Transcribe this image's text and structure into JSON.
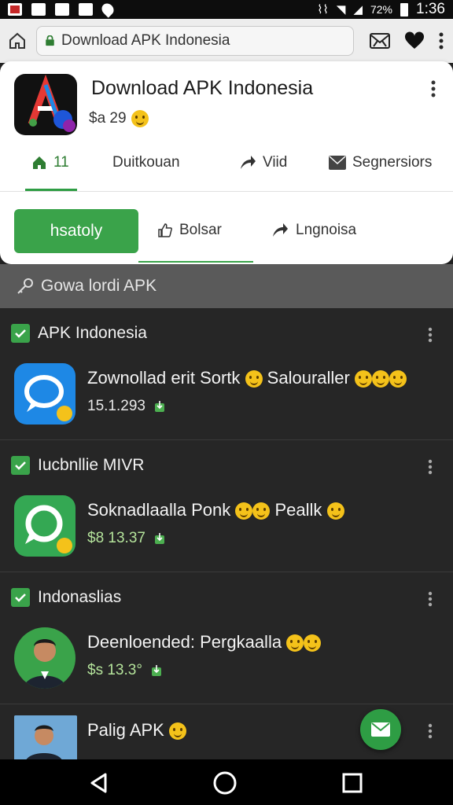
{
  "status_bar": {
    "time": "1:36",
    "battery_text": "72%"
  },
  "browser": {
    "url_text": "Download APK Indonesia"
  },
  "header": {
    "title": "Download APK Indonesia",
    "rating": "$a 29",
    "tabs": [
      {
        "label": "11",
        "icon": "home-icon"
      },
      {
        "label": "Duitkouan",
        "icon": ""
      },
      {
        "label": "Viid",
        "icon": "share-icon"
      },
      {
        "label": "Segnersiors",
        "icon": "mail-icon"
      }
    ],
    "actions": {
      "install_label": "hsatoly",
      "like_label": "Bolsar",
      "share_label": "Lngnoisa"
    }
  },
  "search": {
    "placeholder": "Gowa lordi APK"
  },
  "list": {
    "sections": [
      {
        "header": "APK Indonesia",
        "title": "Zownollad erit Sortk",
        "title_tail": "Salouraller",
        "meta": "15.1.293",
        "icon": "chat-bubble-icon"
      },
      {
        "header": "Iucbnllie MIVR",
        "title": "Soknadlaalla Ponk",
        "title_tail": "Peallk",
        "meta": "$8 13.37",
        "icon": "phone-chat-icon"
      },
      {
        "header": "Indonaslias",
        "title": "Deenloended: Pergkaalla",
        "title_tail": "",
        "meta": "$s 13.3°",
        "icon": "avatar-icon"
      },
      {
        "header": "",
        "title": "Palig APK",
        "title_tail": "",
        "meta": "",
        "subtitle": "",
        "icon": "photo-icon"
      }
    ]
  },
  "colors": {
    "accent_green": "#3aa34a",
    "card_bg": "#ffffff",
    "list_bg": "#262626"
  }
}
